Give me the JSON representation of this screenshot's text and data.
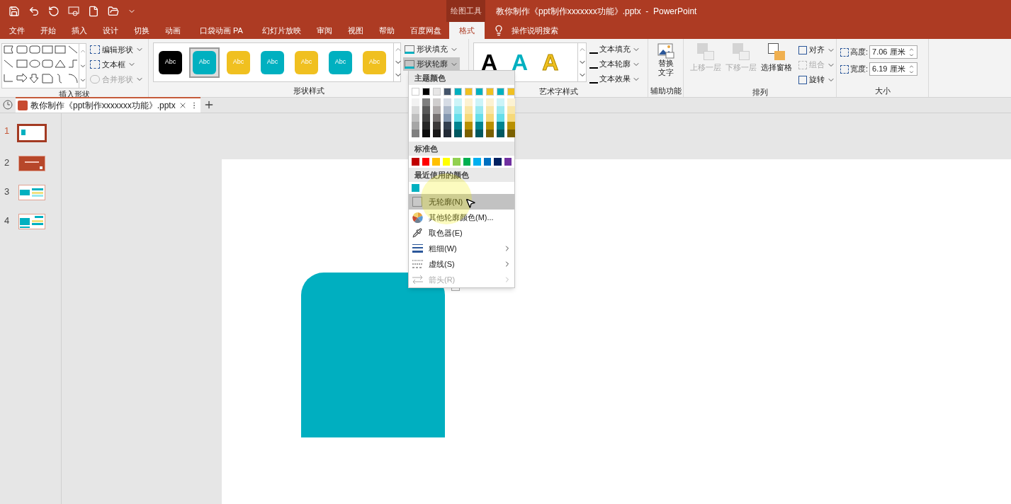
{
  "title_bar": {
    "context_label": "绘图工具",
    "title": "教你制作《ppt制作xxxxxxx功能》.pptx  -  PowerPoint"
  },
  "tabs": [
    {
      "label": "文件",
      "selected": false
    },
    {
      "label": "开始",
      "selected": false
    },
    {
      "label": "插入",
      "selected": false
    },
    {
      "label": "设计",
      "selected": false
    },
    {
      "label": "切换",
      "selected": false
    },
    {
      "label": "动画",
      "selected": false
    },
    {
      "label": "口袋动画 PA",
      "selected": false
    },
    {
      "label": "幻灯片放映",
      "selected": false
    },
    {
      "label": "审阅",
      "selected": false
    },
    {
      "label": "视图",
      "selected": false
    },
    {
      "label": "帮助",
      "selected": false
    },
    {
      "label": "百度网盘",
      "selected": false
    },
    {
      "label": "格式",
      "selected": true
    }
  ],
  "tell_me": "操作说明搜索",
  "insert_shapes": {
    "label": "插入形状",
    "buttons": [
      {
        "label": "编辑形状",
        "disabled": false
      },
      {
        "label": "文本框",
        "disabled": false
      },
      {
        "label": "合并形状",
        "disabled": true
      }
    ]
  },
  "shape_styles": {
    "label": "形状样式",
    "swatches": [
      {
        "label": "Abc",
        "color": "#000000",
        "selected": false
      },
      {
        "label": "Abc",
        "color": "#00b0c0",
        "selected": true
      },
      {
        "label": "Abc",
        "color": "#f0c020",
        "selected": false
      },
      {
        "label": "Abc",
        "color": "#00b0c0",
        "selected": false
      },
      {
        "label": "Abc",
        "color": "#f0c020",
        "selected": false
      },
      {
        "label": "Abc",
        "color": "#00b0c0",
        "selected": false
      },
      {
        "label": "Abc",
        "color": "#f0c020",
        "selected": false
      }
    ],
    "buttons": [
      {
        "label": "形状填充",
        "open": false
      },
      {
        "label": "形状轮廓",
        "open": true
      }
    ]
  },
  "wordart": {
    "label": "艺术字样式",
    "samples": [
      {
        "label": "A",
        "kind": "fill",
        "color": "#000000"
      },
      {
        "label": "A",
        "kind": "fill",
        "color": "#00b0c0"
      },
      {
        "label": "A",
        "kind": "outline",
        "color": "#f0c020"
      }
    ],
    "buttons": [
      {
        "label": "文本填充"
      },
      {
        "label": "文本轮廓"
      },
      {
        "label": "文本效果"
      }
    ]
  },
  "accessibility": {
    "label": "辅助功能",
    "button": [
      "替换",
      "文字"
    ]
  },
  "arrange": {
    "label": "排列",
    "large": [
      {
        "label": "上移一层",
        "disabled": true
      },
      {
        "label": "下移一层",
        "disabled": true
      },
      {
        "label": "选择窗格",
        "disabled": false
      }
    ],
    "small": [
      {
        "label": "对齐",
        "disabled": false
      },
      {
        "label": "组合",
        "disabled": true
      },
      {
        "label": "旋转",
        "disabled": false
      }
    ]
  },
  "size": {
    "label": "大小",
    "fields": [
      {
        "label": "高度:",
        "value": "7.06 厘米"
      },
      {
        "label": "宽度:",
        "value": "6.19 厘米"
      }
    ]
  },
  "document_tab": {
    "title": "教你制作《ppt制作xxxxxxx功能》.pptx"
  },
  "slides": [
    {
      "number": "1",
      "selected": true
    },
    {
      "number": "2",
      "selected": false
    },
    {
      "number": "3",
      "selected": false
    },
    {
      "number": "4",
      "selected": false
    }
  ],
  "outline_menu": {
    "theme_heading": "主题颜色",
    "theme_colors": [
      {
        "color": "#ffffff",
        "shades": [
          {
            "color": "#f2f2f2"
          },
          {
            "color": "#d9d9d9"
          },
          {
            "color": "#bfbfbf"
          },
          {
            "color": "#a6a6a6"
          },
          {
            "color": "#808080"
          }
        ]
      },
      {
        "color": "#000000",
        "shades": [
          {
            "color": "#7f7f7f"
          },
          {
            "color": "#595959"
          },
          {
            "color": "#404040"
          },
          {
            "color": "#262626"
          },
          {
            "color": "#0d0d0d"
          }
        ]
      },
      {
        "color": "#e7e6e6",
        "shades": [
          {
            "color": "#d0cece"
          },
          {
            "color": "#afabab"
          },
          {
            "color": "#767171"
          },
          {
            "color": "#3b3838"
          },
          {
            "color": "#181717"
          }
        ]
      },
      {
        "color": "#44546a",
        "shades": [
          {
            "color": "#d6dce5"
          },
          {
            "color": "#adb9ca"
          },
          {
            "color": "#8497b0"
          },
          {
            "color": "#333f50"
          },
          {
            "color": "#222a35"
          }
        ]
      },
      {
        "color": "#00b0c0",
        "shades": [
          {
            "color": "#ccf4f8"
          },
          {
            "color": "#99e9f1"
          },
          {
            "color": "#66deea"
          },
          {
            "color": "#008490"
          },
          {
            "color": "#005860"
          }
        ]
      },
      {
        "color": "#f0c020",
        "shades": [
          {
            "color": "#fcf2d2"
          },
          {
            "color": "#f9e6a6"
          },
          {
            "color": "#f6d979"
          },
          {
            "color": "#b89000"
          },
          {
            "color": "#7a6000"
          }
        ]
      },
      {
        "color": "#00b0c0",
        "shades": [
          {
            "color": "#ccf4f8"
          },
          {
            "color": "#99e9f1"
          },
          {
            "color": "#66deea"
          },
          {
            "color": "#008490"
          },
          {
            "color": "#005860"
          }
        ]
      },
      {
        "color": "#f0c020",
        "shades": [
          {
            "color": "#fcf2d2"
          },
          {
            "color": "#f9e6a6"
          },
          {
            "color": "#f6d979"
          },
          {
            "color": "#b89000"
          },
          {
            "color": "#7a6000"
          }
        ]
      },
      {
        "color": "#00b0c0",
        "shades": [
          {
            "color": "#ccf4f8"
          },
          {
            "color": "#99e9f1"
          },
          {
            "color": "#66deea"
          },
          {
            "color": "#008490"
          },
          {
            "color": "#005860"
          }
        ]
      },
      {
        "color": "#f0c020",
        "shades": [
          {
            "color": "#fcf2d2"
          },
          {
            "color": "#f9e6a6"
          },
          {
            "color": "#f6d979"
          },
          {
            "color": "#b89000"
          },
          {
            "color": "#7a6000"
          }
        ]
      }
    ],
    "standard_heading": "标准色",
    "standard_colors": [
      {
        "color": "#c00000"
      },
      {
        "color": "#ff0000"
      },
      {
        "color": "#ffc000"
      },
      {
        "color": "#ffff00"
      },
      {
        "color": "#92d050"
      },
      {
        "color": "#00b050"
      },
      {
        "color": "#00b0f0"
      },
      {
        "color": "#0070c0"
      },
      {
        "color": "#002060"
      },
      {
        "color": "#7030a0"
      }
    ],
    "recent_heading": "最近使用的颜色",
    "recent_colors": [
      {
        "color": "#00b0c0"
      }
    ],
    "items": [
      {
        "kind": "none",
        "label": "无轮廓(N)",
        "highlighted": true,
        "disabled": false,
        "submenu": false
      },
      {
        "kind": "more",
        "label": "其他轮廓颜色(M)...",
        "highlighted": false,
        "disabled": false,
        "submenu": false
      },
      {
        "kind": "eyedropper",
        "label": "取色器(E)",
        "highlighted": false,
        "disabled": false,
        "submenu": false
      },
      {
        "kind": "weight",
        "label": "粗细(W)",
        "highlighted": false,
        "disabled": false,
        "submenu": true
      },
      {
        "kind": "dashes",
        "label": "虚线(S)",
        "highlighted": false,
        "disabled": false,
        "submenu": true
      },
      {
        "kind": "arrows",
        "label": "箭头(R)",
        "highlighted": false,
        "disabled": true,
        "submenu": true
      }
    ]
  }
}
